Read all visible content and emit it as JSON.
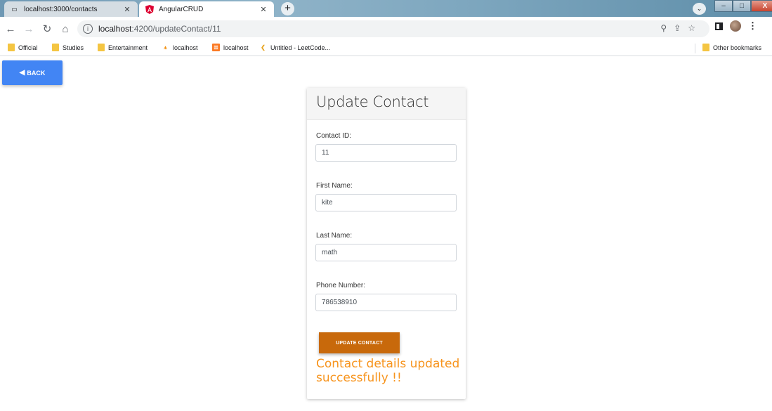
{
  "browser": {
    "tabs": [
      {
        "title": "localhost:3000/contacts",
        "icon": "page-icon",
        "active": false
      },
      {
        "title": "AngularCRUD",
        "icon": "angular-icon",
        "active": true
      }
    ],
    "new_tab_label": "+",
    "url_host": "localhost",
    "url_path": ":4200/updateContact/11"
  },
  "bookmarks": [
    {
      "label": "Official",
      "icon": "folder-icon"
    },
    {
      "label": "Studies",
      "icon": "folder-icon"
    },
    {
      "label": "Entertainment",
      "icon": "folder-icon"
    },
    {
      "label": "localhost",
      "icon": "pma-icon"
    },
    {
      "label": "localhost",
      "icon": "xampp-icon"
    },
    {
      "label": "Untitled - LeetCode...",
      "icon": "leetcode-icon"
    }
  ],
  "other_bookmarks": "Other bookmarks",
  "page": {
    "back_label": "BACK",
    "card_title": "Update Contact",
    "fields": [
      {
        "label": "Contact ID:",
        "value": "11"
      },
      {
        "label": "First Name:",
        "value": "kite"
      },
      {
        "label": "Last Name:",
        "value": "math"
      },
      {
        "label": "Phone Number:",
        "value": "786538910"
      }
    ],
    "update_label": "UPDATE CONTACT",
    "success_message": "Contact details updated successfully !!"
  },
  "colors": {
    "back_button": "#4285f4",
    "update_button": "#c8690b",
    "success_text": "#f7941d"
  }
}
